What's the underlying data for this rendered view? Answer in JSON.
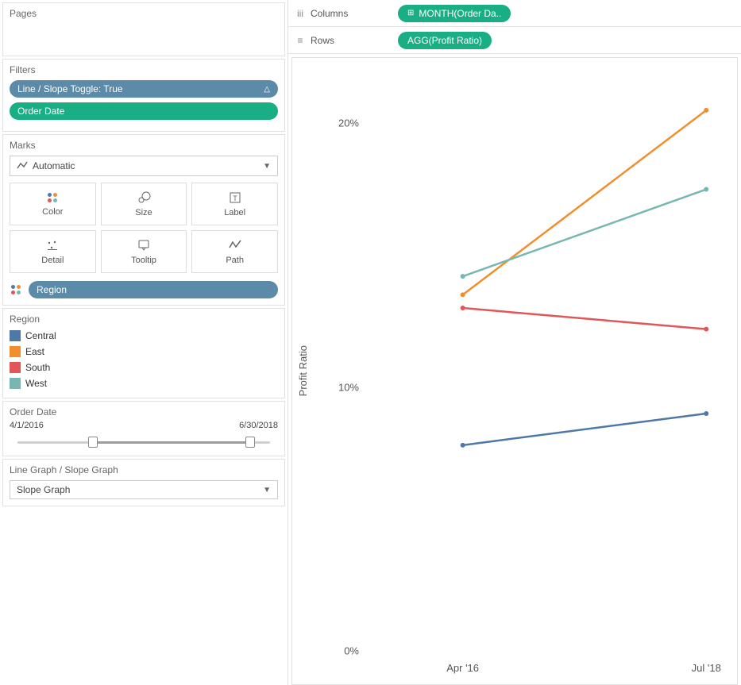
{
  "left": {
    "pages_title": "Pages",
    "filters_title": "Filters",
    "filter_pill_toggle": "Line / Slope Toggle: True",
    "filter_pill_date": "Order Date",
    "marks_title": "Marks",
    "marks_type": "Automatic",
    "marks_cells": {
      "color": "Color",
      "size": "Size",
      "label": "Label",
      "detail": "Detail",
      "tooltip": "Tooltip",
      "path": "Path"
    },
    "marks_region_pill": "Region",
    "legend_title": "Region",
    "date_card_title": "Order Date",
    "date_from": "4/1/2016",
    "date_to": "6/30/2018",
    "param_title": "Line Graph / Slope Graph",
    "param_value": "Slope Graph"
  },
  "shelves": {
    "columns_label": "Columns",
    "columns_pill": "MONTH(Order Da..",
    "rows_label": "Rows",
    "rows_pill": "AGG(Profit Ratio)"
  },
  "legend": [
    {
      "name": "Central",
      "color": "#4e79a7"
    },
    {
      "name": "East",
      "color": "#f28e2b"
    },
    {
      "name": "South",
      "color": "#e15759"
    },
    {
      "name": "West",
      "color": "#76b7b2"
    }
  ],
  "chart_data": {
    "type": "line",
    "title": "",
    "ylabel": "Profit Ratio",
    "xlabel": "",
    "categories": [
      "Apr '16",
      "Jul '18"
    ],
    "ylim": [
      0,
      0.22
    ],
    "yticks": [
      0,
      0.1,
      0.2
    ],
    "ytick_labels": [
      "0%",
      "10%",
      "20%"
    ],
    "series": [
      {
        "name": "Central",
        "color": "#4e79a7",
        "values": [
          0.078,
          0.09
        ]
      },
      {
        "name": "East",
        "color": "#f28e2b",
        "values": [
          0.135,
          0.205
        ]
      },
      {
        "name": "South",
        "color": "#e15759",
        "values": [
          0.13,
          0.122
        ]
      },
      {
        "name": "West",
        "color": "#76b7b2",
        "values": [
          0.142,
          0.175
        ]
      }
    ]
  },
  "slider": {
    "start_pct": 30,
    "end_pct": 92
  }
}
